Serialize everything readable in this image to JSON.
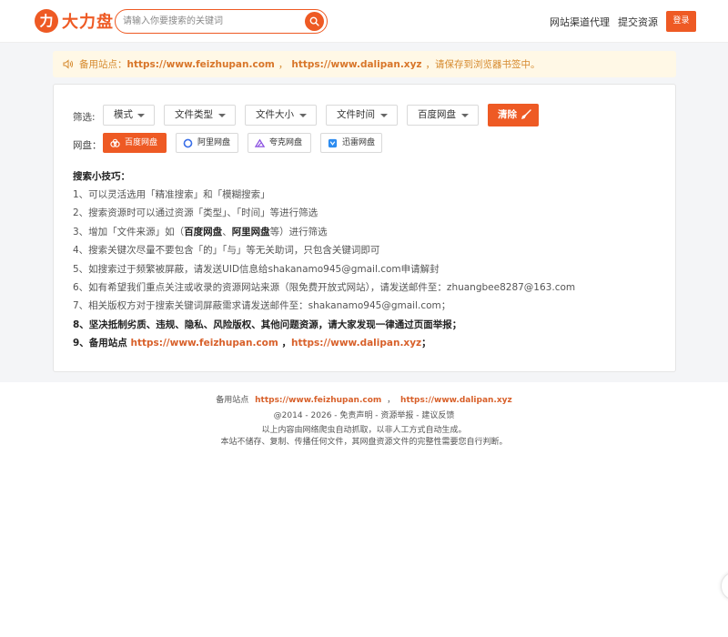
{
  "header": {
    "logo_mark": "力",
    "logo_text": "大力盘",
    "search_placeholder": "请输入你要搜索的关键词",
    "nav": [
      "网站渠道代理",
      "提交资源"
    ],
    "login": "登录"
  },
  "notice": {
    "prefix": "备用站点：",
    "url1": "https://www.feizhupan.com",
    "sep": "，",
    "url2": "https://www.dalipan.xyz",
    "suffix": "，请保存到浏览器书签中。"
  },
  "filters": {
    "label": "筛选:",
    "dropdowns": [
      "模式",
      "文件类型",
      "文件大小",
      "文件时间",
      "百度网盘"
    ],
    "clear": "清除"
  },
  "pans": {
    "label": "网盘：",
    "items": [
      "百度网盘",
      "阿里网盘",
      "夸克网盘",
      "迅雷网盘"
    ],
    "active": "百度网盘"
  },
  "tips": {
    "title": "搜索小技巧：",
    "items": [
      "1、可以灵活选用「精准搜索」和「模糊搜索」",
      "2、搜索资源时可以通过资源「类型」、「时间」等进行筛选",
      {
        "a": "3、增加「文件来源」如（",
        "b1": "百度网盘",
        "c": "、",
        "b2": "阿里网盘",
        "d": "等）进行筛选"
      },
      "4、搜索关键次尽量不要包含「的」「与」等无关助词，只包含关键词即可",
      "5、如搜索过于频繁被屏蔽，请发送UID信息给shakanamo945@gmail.com申请解封",
      "6、如有希望我们重点关注或收录的资源网站来源（限免费开放式网站），请发送邮件至：zhuangbee8287@163.com",
      "7、相关版权方对于搜索关键词屏蔽需求请发送邮件至：shakanamo945@gmail.com；",
      "8、坚决抵制劣质、违规、隐私、风险版权、其他问题资源，请大家发现一律通过页面举报；",
      {
        "a": "9、备用站点 ",
        "url1": "https://www.feizhupan.com",
        "sep": " ，",
        "url2": "https://www.dalipan.xyz",
        "end": "；"
      }
    ]
  },
  "footer": {
    "backup_prefix": "备用站点",
    "url1": "https://www.feizhupan.com",
    "sep": "，",
    "url2": "https://www.dalipan.xyz",
    "links": "@2014 - 2026 - 免责声明 - 资源举报 - 建议反馈",
    "line3": "以上内容由网络爬虫自动抓取，以非人工方式自动生成。",
    "line4": "本站不储存、复制、传播任何文件，其网盘资源文件的完整性需要您自行判断。"
  },
  "colors": {
    "accent": "#ee5a24",
    "notice_bg": "#fff8e6",
    "notice_text": "#d68a2e"
  }
}
